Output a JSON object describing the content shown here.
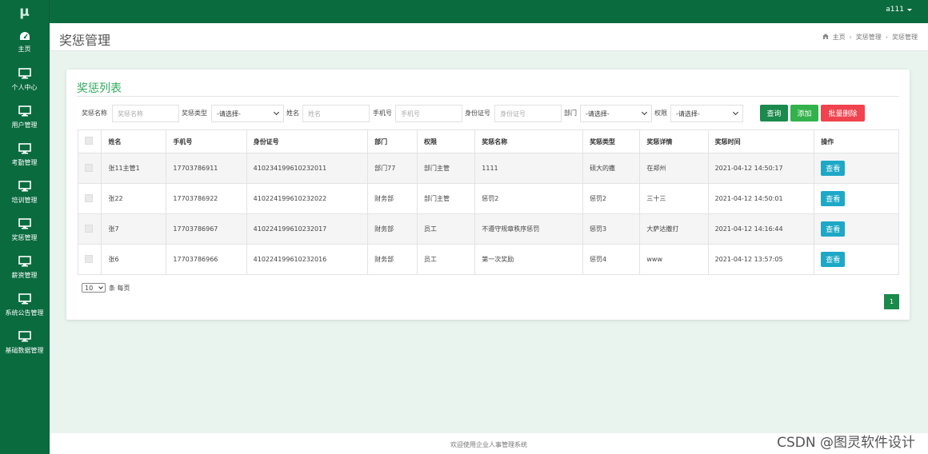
{
  "sidebar": {
    "logo": "μ",
    "items": [
      {
        "label": "主页",
        "icon": "dashboard-icon"
      },
      {
        "label": "个人中心",
        "icon": "monitor-icon"
      },
      {
        "label": "用户管理",
        "icon": "monitor-icon"
      },
      {
        "label": "考勤管理",
        "icon": "monitor-icon"
      },
      {
        "label": "培训管理",
        "icon": "monitor-icon"
      },
      {
        "label": "奖惩管理",
        "icon": "monitor-icon"
      },
      {
        "label": "薪资管理",
        "icon": "monitor-icon"
      },
      {
        "label": "系统公告管理",
        "icon": "monitor-icon"
      },
      {
        "label": "基础数据管理",
        "icon": "monitor-icon"
      }
    ]
  },
  "topbar": {
    "user": "a111"
  },
  "header": {
    "title": "奖惩管理",
    "breadcrumb": [
      "主页",
      "奖惩管理",
      "奖惩管理"
    ]
  },
  "panel": {
    "title": "奖惩列表",
    "search": {
      "name_label": "奖惩名称",
      "name_placeholder": "奖惩名称",
      "type_label": "奖惩类型",
      "type_value": "-请选择-",
      "person_label": "姓名",
      "person_placeholder": "姓名",
      "phone_label": "手机号",
      "phone_placeholder": "手机号",
      "id_label": "身份证号",
      "id_placeholder": "身份证号",
      "dept_label": "部门",
      "dept_value": "-请选择-",
      "role_label": "权限",
      "role_value": "-请选择-"
    },
    "buttons": {
      "query": "查询",
      "add": "添加",
      "batch_delete": "批量删除"
    },
    "table": {
      "columns": [
        "姓名",
        "手机号",
        "身份证号",
        "部门",
        "权限",
        "奖惩名称",
        "奖惩类型",
        "奖惩详情",
        "奖惩时间",
        "操作"
      ],
      "rows": [
        {
          "name": "张11主管1",
          "phone": "17703786911",
          "id": "410234199610232011",
          "dept": "部门77",
          "role": "部门主管",
          "title": "1111",
          "type": "硕大的撒",
          "detail": "在郑州",
          "time": "2021-04-12 14:50:17",
          "action": "查看"
        },
        {
          "name": "张22",
          "phone": "17703786922",
          "id": "410224199610232022",
          "dept": "财务部",
          "role": "部门主管",
          "title": "惩罚2",
          "type": "惩罚2",
          "detail": "三十三",
          "time": "2021-04-12 14:50:01",
          "action": "查看"
        },
        {
          "name": "张7",
          "phone": "17703786967",
          "id": "410224199610232017",
          "dept": "财务部",
          "role": "员工",
          "title": "不遵守规章秩序惩罚",
          "type": "惩罚3",
          "detail": "大萨达撒打",
          "time": "2021-04-12 14:16:44",
          "action": "查看"
        },
        {
          "name": "张6",
          "phone": "17703786966",
          "id": "410224199610232016",
          "dept": "财务部",
          "role": "员工",
          "title": "第一次奖励",
          "type": "惩罚4",
          "detail": "www",
          "time": "2021-04-12 13:57:05",
          "action": "查看"
        }
      ]
    },
    "page_size": {
      "value": "10",
      "suffix": "条 每页"
    },
    "pagination": {
      "current": "1"
    }
  },
  "footer": {
    "text": "欢迎使用企业人事管理系统"
  },
  "watermark": "CSDN @图灵软件设计",
  "colors": {
    "brand": "#0a6b3f",
    "accent_green": "#2eaa5c",
    "danger": "#f0434e",
    "info": "#1ea8c6"
  }
}
